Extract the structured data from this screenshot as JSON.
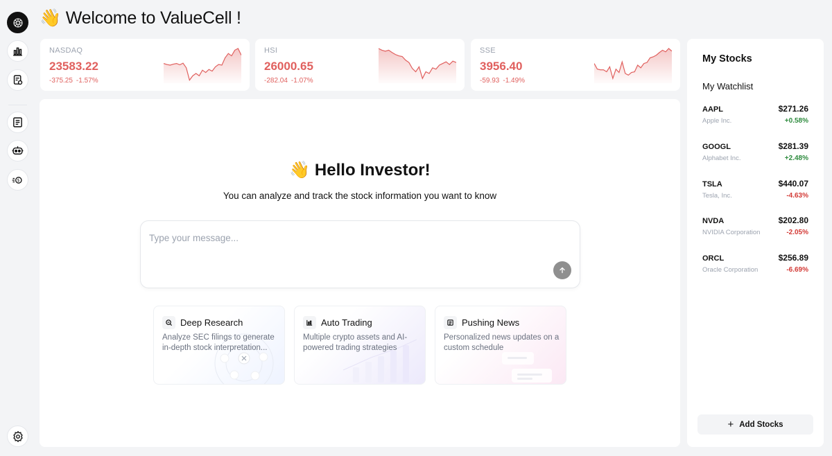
{
  "header": {
    "emoji": "👋",
    "title": "Welcome to ValueCell !"
  },
  "sidebar": {
    "items": [
      {
        "icon": "logo-icon",
        "label": ""
      },
      {
        "icon": "bar-chart-icon"
      },
      {
        "icon": "report-icon"
      },
      {
        "icon": "news-icon"
      },
      {
        "icon": "robot-icon"
      },
      {
        "icon": "agent-icon"
      },
      {
        "icon": "gear-icon"
      }
    ]
  },
  "indices": [
    {
      "name": "NASDAQ",
      "value": "23583.22",
      "change": "-375.25",
      "percent": "-1.57%",
      "trend": [
        0.55,
        0.52,
        0.5,
        0.53,
        0.55,
        0.51,
        0.56,
        0.42,
        0.05,
        0.18,
        0.25,
        0.18,
        0.35,
        0.28,
        0.37,
        0.32,
        0.45,
        0.52,
        0.5,
        0.72,
        0.85,
        0.78,
        0.95,
        1.0,
        0.8
      ]
    },
    {
      "name": "HSI",
      "value": "26000.65",
      "change": "-282.04",
      "percent": "-1.07%",
      "trend": [
        1.0,
        0.95,
        0.92,
        0.95,
        0.88,
        0.82,
        0.78,
        0.76,
        0.65,
        0.58,
        0.4,
        0.3,
        0.45,
        0.1,
        0.3,
        0.25,
        0.42,
        0.38,
        0.5,
        0.55,
        0.6,
        0.52,
        0.62,
        0.58
      ]
    },
    {
      "name": "SSE",
      "value": "3956.40",
      "change": "-59.93",
      "percent": "-1.49%",
      "trend": [
        0.55,
        0.38,
        0.36,
        0.36,
        0.3,
        0.45,
        0.1,
        0.38,
        0.28,
        0.6,
        0.25,
        0.2,
        0.28,
        0.3,
        0.5,
        0.42,
        0.55,
        0.58,
        0.72,
        0.75,
        0.8,
        0.88,
        0.95,
        0.9,
        1.0,
        0.92
      ]
    }
  ],
  "main": {
    "hello_emoji": "👋",
    "hello_title": "Hello Investor!",
    "subtitle": "You can analyze and track the stock information you want to know",
    "chat_placeholder": "Type your message...",
    "features": [
      {
        "icon": "search-icon",
        "title": "Deep Research",
        "desc": "Analyze SEC filings to generate in-depth stock interpretation..."
      },
      {
        "icon": "trading-chart-icon",
        "title": "Auto Trading",
        "desc": "Multiple crypto assets and AI-powered trading strategies"
      },
      {
        "icon": "newspaper-icon",
        "title": "Pushing News",
        "desc": "Personalized news updates on a custom schedule"
      }
    ]
  },
  "right_panel": {
    "title": "My Stocks",
    "watchlist_title": "My Watchlist",
    "stocks": [
      {
        "ticker": "AAPL",
        "name": "Apple Inc.",
        "price": "$271.26",
        "change": "+0.58%",
        "direction": "up"
      },
      {
        "ticker": "GOOGL",
        "name": "Alphabet Inc.",
        "price": "$281.39",
        "change": "+2.48%",
        "direction": "up"
      },
      {
        "ticker": "TSLA",
        "name": "Tesla, Inc.",
        "price": "$440.07",
        "change": "-4.63%",
        "direction": "down"
      },
      {
        "ticker": "NVDA",
        "name": "NVIDIA Corporation",
        "price": "$202.80",
        "change": "-2.05%",
        "direction": "down"
      },
      {
        "ticker": "ORCL",
        "name": "Oracle Corporation",
        "price": "$256.89",
        "change": "-6.69%",
        "direction": "down"
      }
    ],
    "add_label": "Add Stocks"
  },
  "colors": {
    "negative": "#e0605e",
    "positive": "#2e8b3e",
    "down_strong": "#d33a36"
  }
}
